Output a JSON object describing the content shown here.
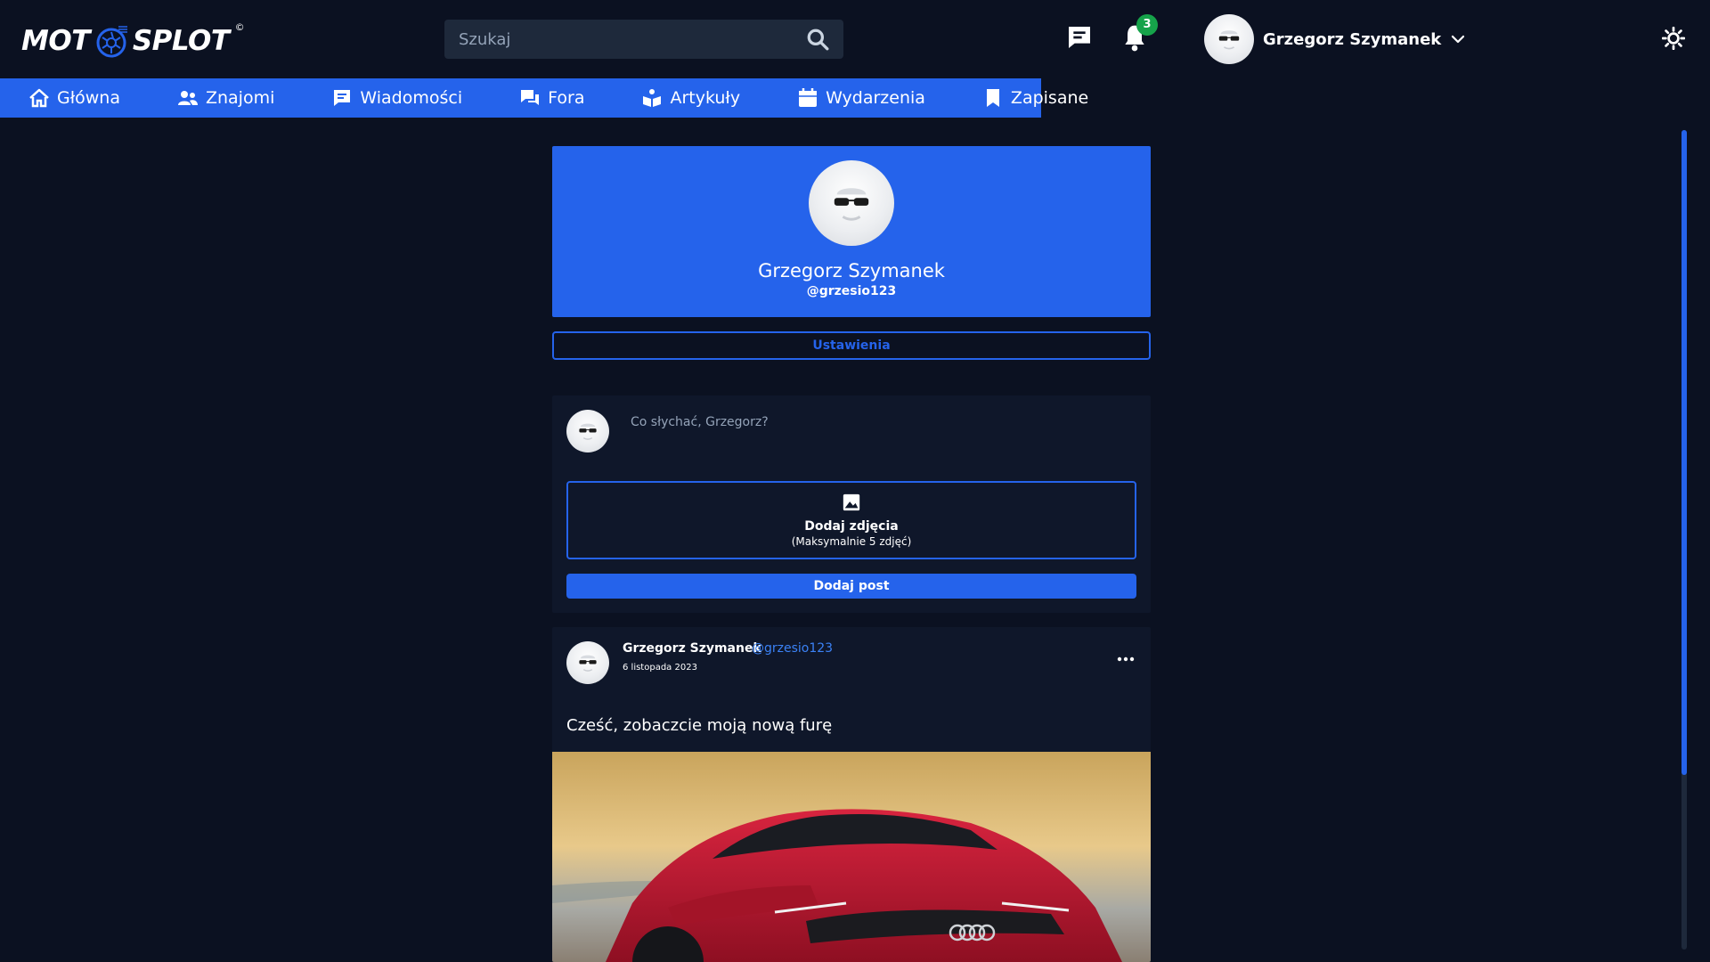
{
  "brand": {
    "logo_left": "MOT",
    "logo_right": "SPLOT",
    "logo_mark": "©"
  },
  "search": {
    "placeholder": "Szukaj",
    "icon": "search-icon"
  },
  "header": {
    "messages_icon": "chat-icon",
    "notifications_icon": "bell-icon",
    "notifications_count": "3",
    "user_name": "Grzegorz Szymanek",
    "dropdown_icon": "chevron-down-icon",
    "theme_icon": "sun-icon"
  },
  "nav": {
    "items": [
      {
        "label": "Główna",
        "icon": "home-icon"
      },
      {
        "label": "Znajomi",
        "icon": "users-icon"
      },
      {
        "label": "Wiadomości",
        "icon": "message-icon"
      },
      {
        "label": "Fora",
        "icon": "forum-icon"
      },
      {
        "label": "Artykuły",
        "icon": "articles-icon"
      },
      {
        "label": "Wydarzenia",
        "icon": "calendar-icon"
      },
      {
        "label": "Zapisane",
        "icon": "bookmark-icon"
      }
    ]
  },
  "profile": {
    "name": "Grzegorz Szymanek",
    "handle": "@grzesio123",
    "settings_label": "Ustawienia"
  },
  "composer": {
    "placeholder": "Co słychać, Grzegorz?",
    "add_photos_label": "Dodaj zdjęcia",
    "add_photos_hint": "(Maksymalnie 5 zdjęć)",
    "submit_label": "Dodaj post"
  },
  "post": {
    "author": "Grzegorz Szymanek",
    "handle": "@grzesio123",
    "date": "6 listopada 2023",
    "text": "Cześć, zobaczcie moją nową furę",
    "more_icon": "more-horizontal-icon"
  },
  "colors": {
    "background": "#0b1121",
    "surface": "#0f172a",
    "accent": "#2563eb",
    "badge": "#16a34a"
  }
}
